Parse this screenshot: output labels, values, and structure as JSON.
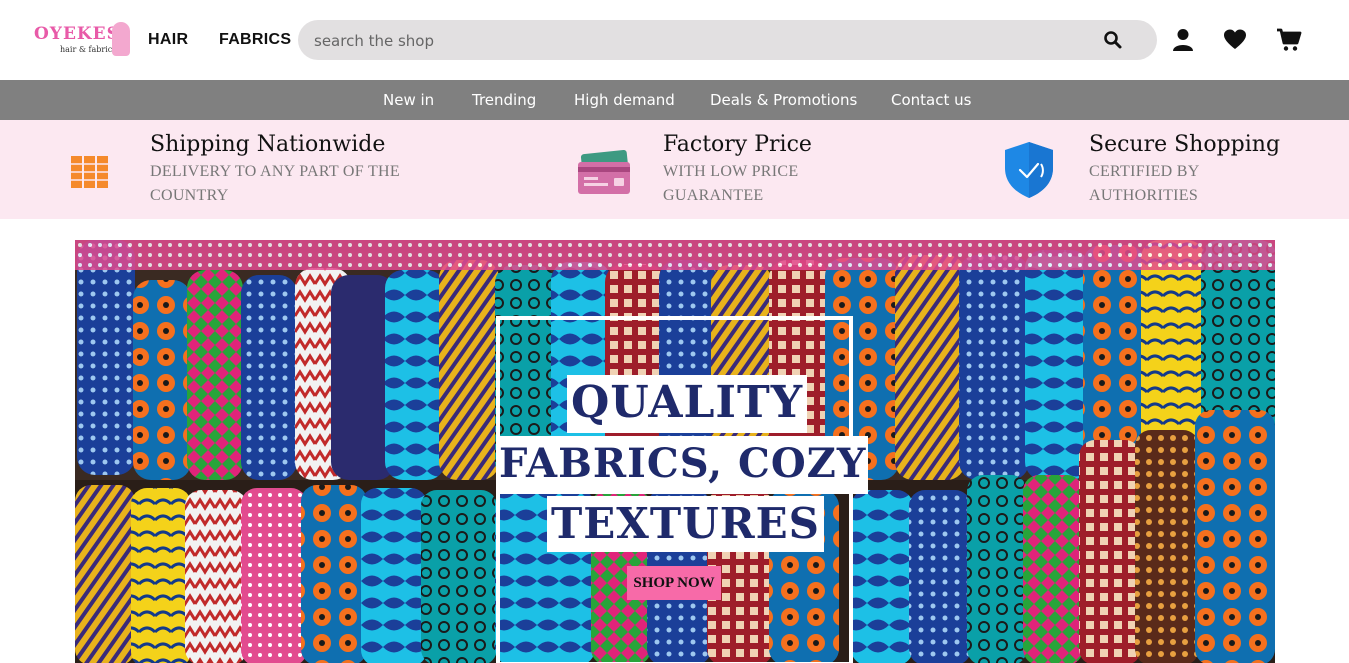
{
  "brand": {
    "name": "OYEKES",
    "tagline": "hair & fabrics",
    "pink": "#e85aa8"
  },
  "header": {
    "nav": [
      "HAIR",
      "FABRICS"
    ],
    "search_placeholder": "search the shop",
    "icons": [
      "search-icon",
      "user-icon",
      "heart-icon",
      "cart-icon"
    ]
  },
  "categories": [
    "New in",
    "Trending",
    "High demand",
    "Deals & Promotions",
    "Contact us"
  ],
  "features": [
    {
      "icon": "package-icon",
      "title": "Shipping Nationwide",
      "line1": "DELIVERY TO ANY PART OF THE",
      "line2": "COUNTRY"
    },
    {
      "icon": "credit-card-icon",
      "title": "Factory Price",
      "line1": "WITH LOW PRICE",
      "line2": "GUARANTEE"
    },
    {
      "icon": "shield-check-icon",
      "title": "Secure Shopping",
      "line1": "CERTIFIED BY",
      "line2": "AUTHORITIES"
    }
  ],
  "hero": {
    "line1": "QUALITY",
    "line2": "FABRICS, COZY",
    "line3": "TEXTURES",
    "cta": "SHOP NOW",
    "cta_color": "#f76aa8"
  }
}
